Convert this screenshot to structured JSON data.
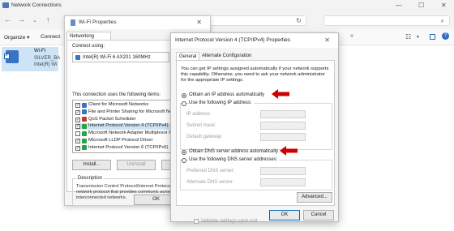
{
  "window": {
    "title": "Network Connections"
  },
  "commandbar": {
    "organize": "Organize ▾",
    "connect": "Connect"
  },
  "adapter_tile": {
    "name": "Wi-Fi",
    "ssid": "SILVER_BA",
    "device": "Intel(R) Wi"
  },
  "props_dialog": {
    "title": "Wi-Fi Properties",
    "tab": "Networking",
    "connect_using": "Connect using:",
    "adapter": "Intel(R) Wi-Fi 6 AX201 160MHz",
    "configure": "C",
    "items_label": "This connection uses the following items:",
    "items": [
      {
        "label": "Client for Microsoft Networks",
        "checked": true,
        "color": "#3a72c4"
      },
      {
        "label": "File and Printer Sharing for Microsoft Network",
        "checked": true,
        "color": "#3a72c4"
      },
      {
        "label": "QoS Packet Scheduler",
        "checked": true,
        "color": "#c0392b"
      },
      {
        "label": "Internet Protocol Version 4 (TCP/IPv4)",
        "checked": true,
        "color": "#27a343"
      },
      {
        "label": "Microsoft Network Adapter Multiplexor Protoc",
        "checked": false,
        "color": "#27a343"
      },
      {
        "label": "Microsoft LLDP Protocol Driver",
        "checked": true,
        "color": "#27a343"
      },
      {
        "label": "Internet Protocol Version 6 (TCP/IPv6)",
        "checked": true,
        "color": "#27a343"
      }
    ],
    "install": "Install...",
    "uninstall": "Uninstall",
    "properties": "Pr",
    "description_label": "Description",
    "description": "Transmission Control Protocol/Internet Protocol. The wide area network protocol that provides communic across diverse interconnected networks.",
    "ok": "OK"
  },
  "ipv4_dialog": {
    "title": "Internet Protocol Version 4 (TCP/IPv4) Properties",
    "tab_general": "General",
    "tab_alternate": "Alternate Configuration",
    "intro": "You can get IP settings assigned automatically if your network supports this capability. Otherwise, you need to ask your network administrator for the appropriate IP settings.",
    "obtain_ip": "Obtain an IP address automatically",
    "use_ip": "Use the following IP address:",
    "ip_address": "IP address:",
    "subnet_mask": "Subnet mask:",
    "default_gateway": "Default gateway:",
    "obtain_dns": "Obtain DNS server address automatically",
    "use_dns": "Use the following DNS server addresses:",
    "preferred_dns": "Preferred DNS server:",
    "alternate_dns": "Alternate DNS server:",
    "validate": "Validate settings upon exit",
    "advanced": "Advanced...",
    "ok": "OK",
    "cancel": "Cancel",
    "arrow_color": "#cc0000"
  }
}
